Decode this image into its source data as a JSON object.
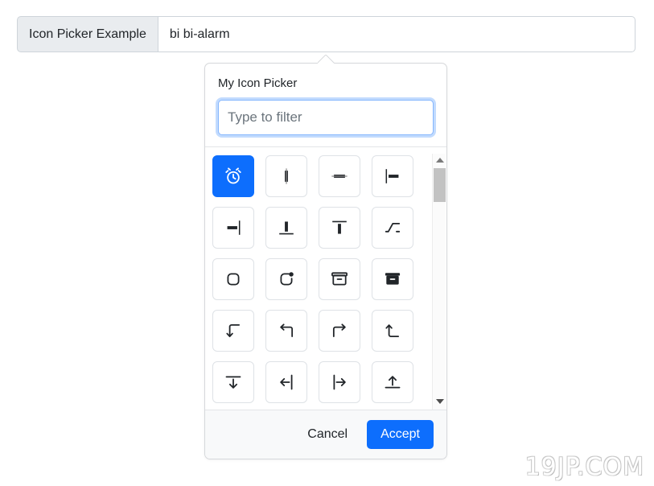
{
  "input_group": {
    "label": "Icon Picker Example",
    "value": "bi bi-alarm"
  },
  "popover": {
    "title": "My Icon Picker",
    "filter": {
      "value": "",
      "placeholder": "Type to filter"
    },
    "icons": [
      {
        "name": "alarm",
        "selected": true
      },
      {
        "name": "align-center",
        "selected": false
      },
      {
        "name": "align-middle",
        "selected": false
      },
      {
        "name": "align-start",
        "selected": false
      },
      {
        "name": "align-end",
        "selected": false
      },
      {
        "name": "align-bottom",
        "selected": false
      },
      {
        "name": "align-top",
        "selected": false
      },
      {
        "name": "alt",
        "selected": false
      },
      {
        "name": "app",
        "selected": false
      },
      {
        "name": "app-indicator",
        "selected": false
      },
      {
        "name": "archive",
        "selected": false
      },
      {
        "name": "archive-fill",
        "selected": false
      },
      {
        "name": "arrow-90deg-down",
        "selected": false
      },
      {
        "name": "arrow-90deg-left",
        "selected": false
      },
      {
        "name": "arrow-90deg-right",
        "selected": false
      },
      {
        "name": "arrow-90deg-up",
        "selected": false
      },
      {
        "name": "arrow-bar-down",
        "selected": false
      },
      {
        "name": "arrow-bar-left",
        "selected": false
      },
      {
        "name": "arrow-bar-right",
        "selected": false
      },
      {
        "name": "arrow-bar-up",
        "selected": false
      }
    ],
    "scrollbar": {
      "up_arrow": "scroll-up-arrow",
      "down_arrow": "scroll-down-arrow"
    },
    "footer": {
      "cancel_label": "Cancel",
      "accept_label": "Accept"
    }
  },
  "watermark": {
    "text": "19JP.COM"
  },
  "colors": {
    "accent": "#0d6efd",
    "focus_ring": "#86b7fe",
    "prepend_bg": "#e9ecef",
    "border": "#ced4da",
    "footer_bg": "#f8f9fa"
  }
}
